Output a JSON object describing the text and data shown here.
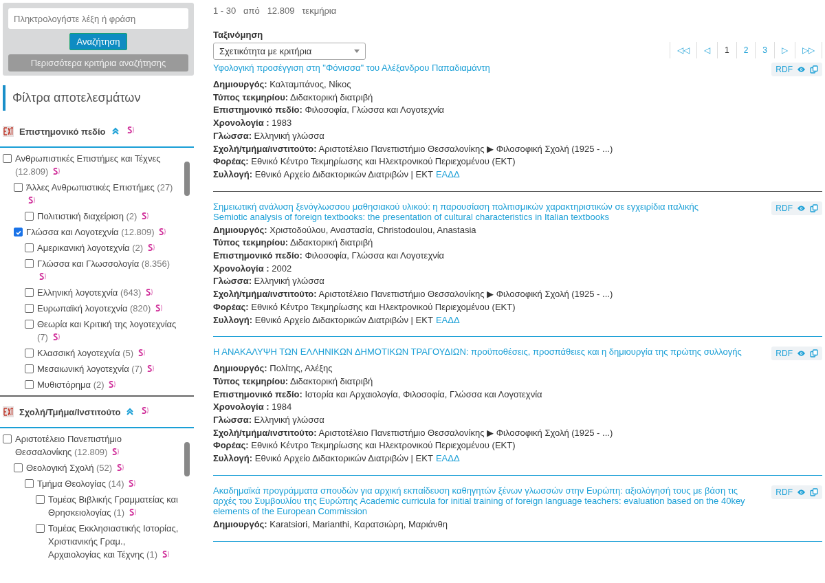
{
  "search": {
    "placeholder": "Πληκτρολογήστε λέξη ή φράση",
    "submit": "Αναζήτηση",
    "more": "Περισσότερα κριτήρια αναζήτησης"
  },
  "filters_title": "Φίλτρα αποτελεσμάτων",
  "facets": [
    {
      "title": "Επιστημονικό πεδίο",
      "expanded": true,
      "items": [
        {
          "label": "Ανθρωπιστικές Επιστήμες και Τέχνες",
          "count": "(12.809)",
          "checked": false,
          "children": [
            {
              "label": "Άλλες Ανθρωπιστικές Επιστήμες",
              "count": "(27)",
              "checked": false,
              "children": [
                {
                  "label": "Πολιτιστική διαχείριση",
                  "count": "(2)",
                  "checked": false
                }
              ]
            },
            {
              "label": "Γλώσσα και Λογοτεχνία",
              "count": "(12.809)",
              "checked": true,
              "children": [
                {
                  "label": "Αμερικανική λογοτεχνία",
                  "count": "(2)",
                  "checked": false
                },
                {
                  "label": "Γλώσσα και Γλωσσολογία",
                  "count": "(8.356)",
                  "checked": false
                },
                {
                  "label": "Ελληνική λογοτεχνία",
                  "count": "(643)",
                  "checked": false
                },
                {
                  "label": "Ευρωπαϊκή λογοτεχνία",
                  "count": "(820)",
                  "checked": false
                },
                {
                  "label": "Θεωρία και Κριτική της λογοτεχνίας",
                  "count": "(7)",
                  "checked": false
                },
                {
                  "label": "Κλασσική λογοτεχνία",
                  "count": "(5)",
                  "checked": false
                },
                {
                  "label": "Μεσαιωνική λογοτεχνία",
                  "count": "(7)",
                  "checked": false
                },
                {
                  "label": "Μυθιστόρημα",
                  "count": "(2)",
                  "checked": false
                }
              ]
            }
          ]
        }
      ]
    },
    {
      "title": "Σχολή/Τμήμα/Ινστιτούτο",
      "expanded": true,
      "items": [
        {
          "label": "Αριστοτέλειο Πανεπιστήμιο Θεσσαλονίκης",
          "count": "(12.809)",
          "checked": false,
          "children": [
            {
              "label": "Θεολογική Σχολή",
              "count": "(52)",
              "checked": false,
              "children": [
                {
                  "label": "Τμήμα Θεολογίας",
                  "count": "(14)",
                  "checked": false,
                  "children": [
                    {
                      "label": "Τομέας Βιβλικής Γραμματείας και Θρησκειολογίας",
                      "count": "(1)",
                      "checked": false
                    },
                    {
                      "label": "Τομέας Εκκλησιαστικής Ιστορίας, Χριστιανικής Γραμ., Αρχαιολογίας και Τέχνης",
                      "count": "(1)",
                      "checked": false
                    }
                  ]
                }
              ]
            }
          ]
        }
      ]
    }
  ],
  "summary": {
    "range_start": "1",
    "dash": "-",
    "range_end": "30",
    "of": "από",
    "total": "12.809",
    "unit": "τεκμήρια"
  },
  "sort": {
    "label": "Ταξινόμηση",
    "value": "Σχετικότητα με κριτήρια"
  },
  "pagination": [
    {
      "label": "◁◁",
      "selected": false
    },
    {
      "label": "◁",
      "selected": false
    },
    {
      "label": "1",
      "selected": true
    },
    {
      "label": "2",
      "selected": false
    },
    {
      "label": "3",
      "selected": false
    },
    {
      "label": "▷",
      "selected": false
    },
    {
      "label": "▷▷",
      "selected": false
    }
  ],
  "records": [
    {
      "title": "Υφολογική προσέγγιση στη \"Φόνισσα\" του Αλέξανδρου Παπαδιαμάντη",
      "rdf": "RDF",
      "fields": [
        {
          "label": "Δημιουργός:",
          "value": "Καλταμπάνος, Νίκος"
        },
        {
          "label": "Τύπος τεκμηρίου:",
          "value": "Διδακτορική διατριβή"
        },
        {
          "label": "Επιστημονικό πεδίο:",
          "value": "Φιλοσοφία, Γλώσσα και Λογοτεχνία"
        },
        {
          "label": "Χρονολογία :",
          "value": "1983"
        },
        {
          "label": "Γλώσσα:",
          "value": "Ελληνική γλώσσα"
        },
        {
          "label": "Σχολή/τμήμα/ινστιτούτο:",
          "value": "Αριστοτέλειο Πανεπιστήμιο Θεσσαλονίκης ▶ Φιλοσοφική Σχολή (1925 - ...)"
        },
        {
          "label": "Φορέας:",
          "value": "Εθνικό Κέντρο Τεκμηρίωσης και Ηλεκτρονικού Περιεχομένου (ΕΚΤ)"
        },
        {
          "label": "Συλλογή:",
          "value": "Εθνικό Αρχείο Διδακτορικών Διατριβών  | ΕΚΤ",
          "link": "ΕΑΔΔ"
        }
      ]
    },
    {
      "title": "Σημειωτική ανάλυση ξενόγλωσσου μαθησιακού υλικού: η παρουσίαση πολιτισμικών χαρακτηριστικών σε εγχειρίδια ιταλικής",
      "subtitle": "Semiotic analysis of foreign textbooks: the presentation of cultural characteristics in Italian textbooks",
      "rdf": "RDF",
      "fields": [
        {
          "label": "Δημιουργός:",
          "value": "Χριστοδούλου, Αναστασία, Christodoulou, Anastasia"
        },
        {
          "label": "Τύπος τεκμηρίου:",
          "value": "Διδακτορική διατριβή"
        },
        {
          "label": "Επιστημονικό πεδίο:",
          "value": "Φιλοσοφία, Γλώσσα και Λογοτεχνία"
        },
        {
          "label": "Χρονολογία :",
          "value": "2002"
        },
        {
          "label": "Γλώσσα:",
          "value": "Ελληνική γλώσσα"
        },
        {
          "label": "Σχολή/τμήμα/ινστιτούτο:",
          "value": "Αριστοτέλειο Πανεπιστήμιο Θεσσαλονίκης ▶ Φιλοσοφική Σχολή (1925 - ...)"
        },
        {
          "label": "Φορέας:",
          "value": "Εθνικό Κέντρο Τεκμηρίωσης και Ηλεκτρονικού Περιεχομένου (ΕΚΤ)"
        },
        {
          "label": "Συλλογή:",
          "value": "Εθνικό Αρχείο Διδακτορικών Διατριβών  | ΕΚΤ",
          "link": "ΕΑΔΔ"
        }
      ]
    },
    {
      "title": "Η ΑΝΑΚΑΛΥΨΗ ΤΩΝ ΕΛΛΗΝΙΚΩΝ ΔΗΜΟΤΙΚΩΝ ΤΡΑΓΟΥΔΙΩΝ: προϋποθέσεις, προσπάθειες και η δημιουργία της πρώτης συλλογής",
      "rdf": "RDF",
      "fields": [
        {
          "label": "Δημιουργός:",
          "value": "Πολίτης, Αλέξης"
        },
        {
          "label": "Τύπος τεκμηρίου:",
          "value": "Διδακτορική διατριβή"
        },
        {
          "label": "Επιστημονικό πεδίο:",
          "value": "Ιστορία και Αρχαιολογία, Φιλοσοφία, Γλώσσα και Λογοτεχνία"
        },
        {
          "label": "Χρονολογία :",
          "value": "1984"
        },
        {
          "label": "Γλώσσα:",
          "value": "Ελληνική γλώσσα"
        },
        {
          "label": "Σχολή/τμήμα/ινστιτούτο:",
          "value": "Αριστοτέλειο Πανεπιστήμιο Θεσσαλονίκης ▶ Φιλοσοφική Σχολή (1925 - ...)"
        },
        {
          "label": "Φορέας:",
          "value": "Εθνικό Κέντρο Τεκμηρίωσης και Ηλεκτρονικού Περιεχομένου (ΕΚΤ)"
        },
        {
          "label": "Συλλογή:",
          "value": "Εθνικό Αρχείο Διδακτορικών Διατριβών  | ΕΚΤ",
          "link": "ΕΑΔΔ"
        }
      ]
    },
    {
      "title": "Ακαδημαϊκά προγράμματα σπουδών για αρχική εκπαίδευση καθηγητών ξένων γλωσσών στην Ευρώπη: αξιολόγησή τους με βάση τις αρχές του Συμβουλίου της Ευρώπης Academic curricula for initial training of foreign language teachers: evaluation based on the 40key elements of the European Commission",
      "rdf": "RDF",
      "fields": [
        {
          "label": "Δημιουργός:",
          "value": "Karatsiori, Marianthi, Καρατσιώρη, Μαριάνθη"
        }
      ]
    }
  ]
}
